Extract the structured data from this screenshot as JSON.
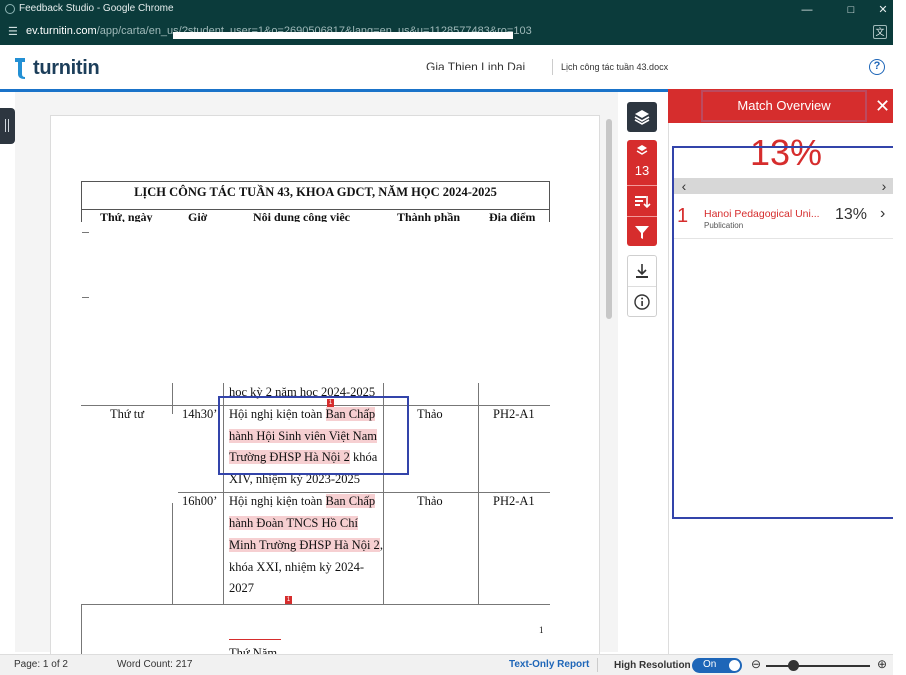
{
  "window": {
    "title": "Feedback Studio - Google Chrome",
    "url_host": "ev.turnitin.com",
    "url_path": "/app/carta/en_us/?student_user=1&o=2690506817&lang=en_us&u=1128577483&ro=103"
  },
  "header": {
    "brand": "turnitin",
    "student_name": "Gia Thien Linh Dai",
    "file_name": "Lịch công tác tuần 43.docx",
    "help_symbol": "?"
  },
  "document": {
    "table_title": "LỊCH CÔNG TÁC TUẦN 43, KHOA GDCT, NĂM HỌC 2024-2025",
    "columns": [
      "Thứ, ngày",
      "Giờ",
      "Nội dung công việc",
      "Thành phần",
      "Địa điểm"
    ],
    "prev_row_tail": "học kỳ 2 năm học 2024-2025",
    "day_label": "Thứ tư",
    "row1": {
      "time": "14h30’",
      "line1_plain": "Hội nghị kiện toàn ",
      "line1_hl": "Ban Chấp",
      "line2_hl": "hành Hội Sinh viên Việt Nam",
      "line3_hl": "Trường ĐHSP Hà Nội 2",
      "line3_plain": " khóa",
      "line4": "XIV, nhiệm kỳ 2023-2025",
      "participants": "Thảo",
      "location": "PH2-A1"
    },
    "row2": {
      "time": "16h00’",
      "line1_plain": "Hội nghị kiện toàn ",
      "line1_hl": "Ban Chấp",
      "line2_hl": "hành Đoàn TNCS Hồ Chí",
      "line3_hl": "Minh Trường ĐHSP Hà Nội 2",
      "line3_plain": ",",
      "line4": "khóa XXI, nhiệm kỳ 2024-",
      "line5": "2027",
      "participants": "Thảo",
      "location": "PH2-A1"
    },
    "match_marker": "1",
    "bottom_stub": "Thứ Năm",
    "bottom_right_stub": "1"
  },
  "rail": {
    "layers_icon": "layers-icon",
    "match_count": "13"
  },
  "panel": {
    "title": "Match Overview",
    "close_symbol": "✕",
    "percent": "13%",
    "prev_symbol": "‹",
    "next_symbol": "›",
    "sources": [
      {
        "rank": "1",
        "name": "Hanoi Pedagogical Uni...",
        "type": "Publication",
        "percent": "13%",
        "chevron": "›"
      }
    ]
  },
  "status": {
    "page": "Page: 1 of 2",
    "word_count": "Word Count: 217",
    "text_only_report": "Text-Only Report",
    "high_resolution": "High Resolution",
    "toggle_state": "On",
    "zoom_out_symbol": "⊖",
    "zoom_in_symbol": "⊕"
  },
  "colors": {
    "accent_red": "#d62d2d",
    "brand_blue": "#1a73c9",
    "annotation_blue": "#3344aa",
    "highlight": "#f6cfd1"
  }
}
